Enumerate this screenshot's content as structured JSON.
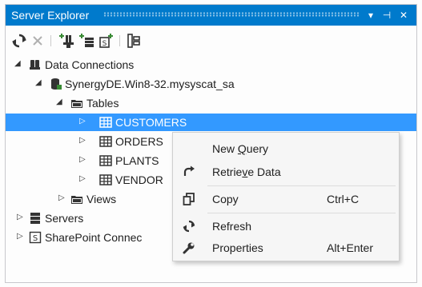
{
  "window": {
    "title": "Server Explorer"
  },
  "titlebar_buttons": {
    "dropdown": "▾",
    "pin": "⊣",
    "close": "✕"
  },
  "toolbar": [
    {
      "name": "refresh-button",
      "icon": "refresh-icon"
    },
    {
      "name": "stop-button",
      "icon": "stop-icon"
    },
    {
      "name": "connect-database-button",
      "icon": "connect-database-icon"
    },
    {
      "name": "connect-server-button",
      "icon": "connect-server-icon"
    },
    {
      "name": "connect-sharepoint-button",
      "icon": "connect-sharepoint-icon"
    },
    {
      "name": "filter-button",
      "icon": "filter-icon"
    }
  ],
  "tree": {
    "data_connections": "Data Connections",
    "connection": "SynergyDE.Win8-32.mysyscat_sa",
    "tables": "Tables",
    "customers": "CUSTOMERS",
    "orders": "ORDERS",
    "plants": "PLANTS",
    "vendors": "VENDOR",
    "views": "Views",
    "servers": "Servers",
    "sharepoint": "SharePoint Connec"
  },
  "context_menu": {
    "new_query": "New Query",
    "new_query_accel": "Q",
    "retrieve_data": "Retrieve Data",
    "retrieve_accel": "v",
    "copy": "Copy",
    "copy_shortcut": "Ctrl+C",
    "refresh": "Refresh",
    "properties": "Properties",
    "properties_shortcut": "Alt+Enter"
  },
  "colors": {
    "accent": "#007acc",
    "selection": "#3399ff"
  }
}
